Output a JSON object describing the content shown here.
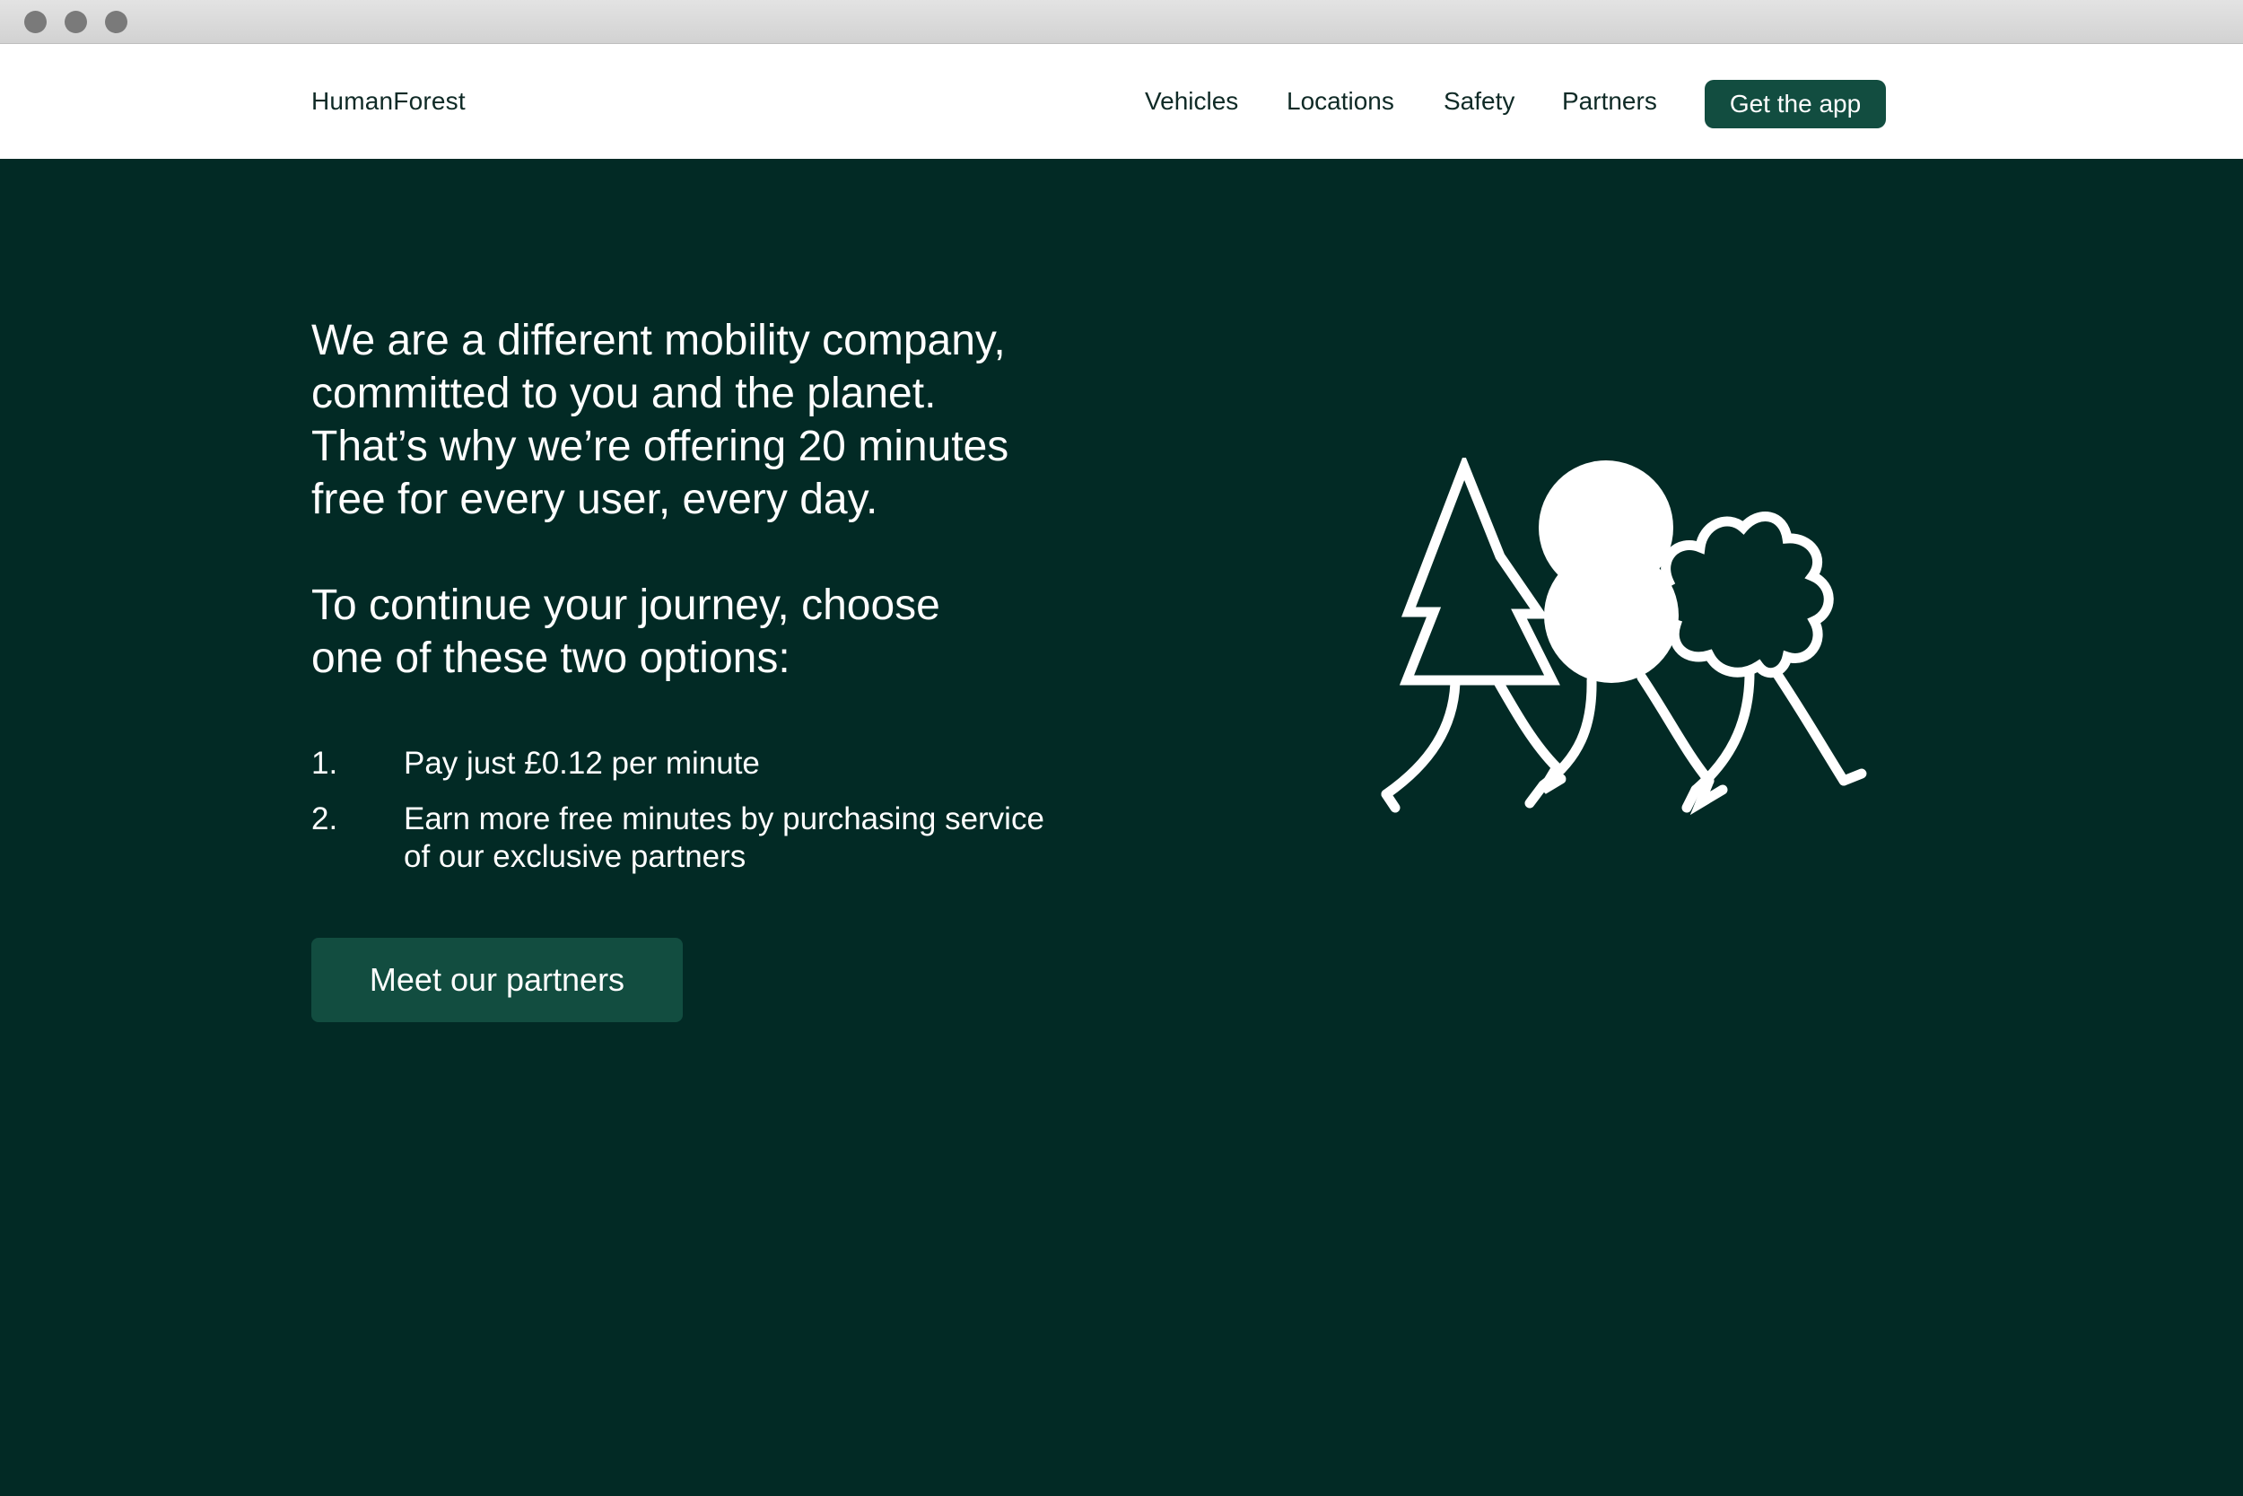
{
  "header": {
    "brand": "HumanForest",
    "nav": [
      "Vehicles",
      "Locations",
      "Safety",
      "Partners"
    ],
    "cta": "Get the app"
  },
  "hero": {
    "headline_lines": [
      "We are a different mobility company,",
      "committed to you and the planet.",
      "That’s why we’re offering 20 minutes",
      "free for every user, every day."
    ],
    "subhead_lines": [
      "To continue your journey, choose",
      "one of these two options:"
    ],
    "options": [
      {
        "number": "1.",
        "text": "Pay just £0.12 per minute"
      },
      {
        "number": "2.",
        "text": "Earn more free minutes by purchasing service of our exclusive partners"
      }
    ],
    "cta": "Meet our partners"
  },
  "colors": {
    "background": "#022a25",
    "button": "#124d40",
    "header_bg": "#ffffff",
    "text_dark": "#0f2a26"
  },
  "icons": {
    "illustration": "walking-trees-illustration"
  }
}
